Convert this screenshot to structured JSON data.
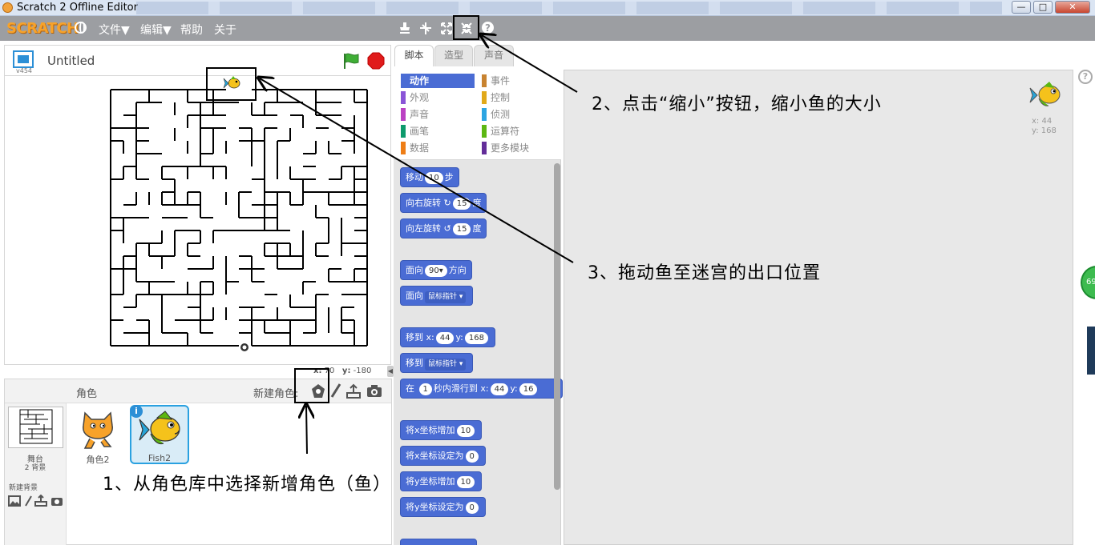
{
  "window": {
    "title": "Scratch 2 Offline Editor",
    "controls": [
      "—",
      "□",
      "✕"
    ]
  },
  "menubar": {
    "logo": "SCRATCH",
    "items": [
      "文件▼",
      "编辑▼",
      "帮助",
      "关于"
    ]
  },
  "stage": {
    "project_title": "Untitled",
    "version": "v454",
    "mouse_x_label": "x:",
    "mouse_x": "70",
    "mouse_y_label": "y:",
    "mouse_y": "-180"
  },
  "tabs": [
    "脚本",
    "造型",
    "声音"
  ],
  "categories": {
    "left": [
      "动作",
      "外观",
      "声音",
      "画笔",
      "数据"
    ],
    "right": [
      "事件",
      "控制",
      "侦测",
      "运算符",
      "更多模块"
    ],
    "colors_left": [
      "#4a6cd4",
      "#8a55d7",
      "#bb42c3",
      "#0e9a6c",
      "#ee7d16"
    ],
    "colors_right": [
      "#c88330",
      "#e1a91a",
      "#2ca5e2",
      "#5cb712",
      "#632d99"
    ]
  },
  "blocks": {
    "move": "移动",
    "move_steps": "10",
    "move_unit": "步",
    "turn_right": "向右旋转",
    "turn_right_deg": "15",
    "deg_unit": "度",
    "turn_left": "向左旋转",
    "turn_left_deg": "15",
    "point_dir": "面向",
    "point_dir_val": "90▾",
    "point_dir_unit": "方向",
    "point_towards": "面向",
    "point_towards_val": "鼠标指针 ▾",
    "goto_xy": "移到 x:",
    "goto_x": "44",
    "goto_y_label": "y:",
    "goto_y": "168",
    "goto": "移到",
    "goto_val": "鼠标指针 ▾",
    "glide_pre": "在",
    "glide_secs": "1",
    "glide_mid": "秒内滑行到 x:",
    "glide_x": "44",
    "glide_y_label": "y:",
    "glide_y": "16",
    "change_x": "将x坐标增加",
    "change_x_val": "10",
    "set_x": "将x坐标设定为",
    "set_x_val": "0",
    "change_y": "将y坐标增加",
    "change_y_val": "10",
    "set_y": "将y坐标设定为",
    "set_y_val": "0"
  },
  "sprites_panel": {
    "header": "角色",
    "new_sprite": "新建角色:",
    "stage_label": "舞台",
    "stage_sub": "2 背景",
    "new_backdrop": "新建背景",
    "sprites": [
      {
        "name": "角色2"
      },
      {
        "name": "Fish2"
      }
    ]
  },
  "scripts_area": {
    "sprite_x_label": "x:",
    "sprite_x": "44",
    "sprite_y_label": "y:",
    "sprite_y": "168",
    "help": "?",
    "badge": "69"
  },
  "annotations": [
    "1、从角色库中选择新增角色（鱼）",
    "2、点击“缩小”按钮，缩小鱼的大小",
    "3、拖动鱼至迷宫的出口位置"
  ]
}
